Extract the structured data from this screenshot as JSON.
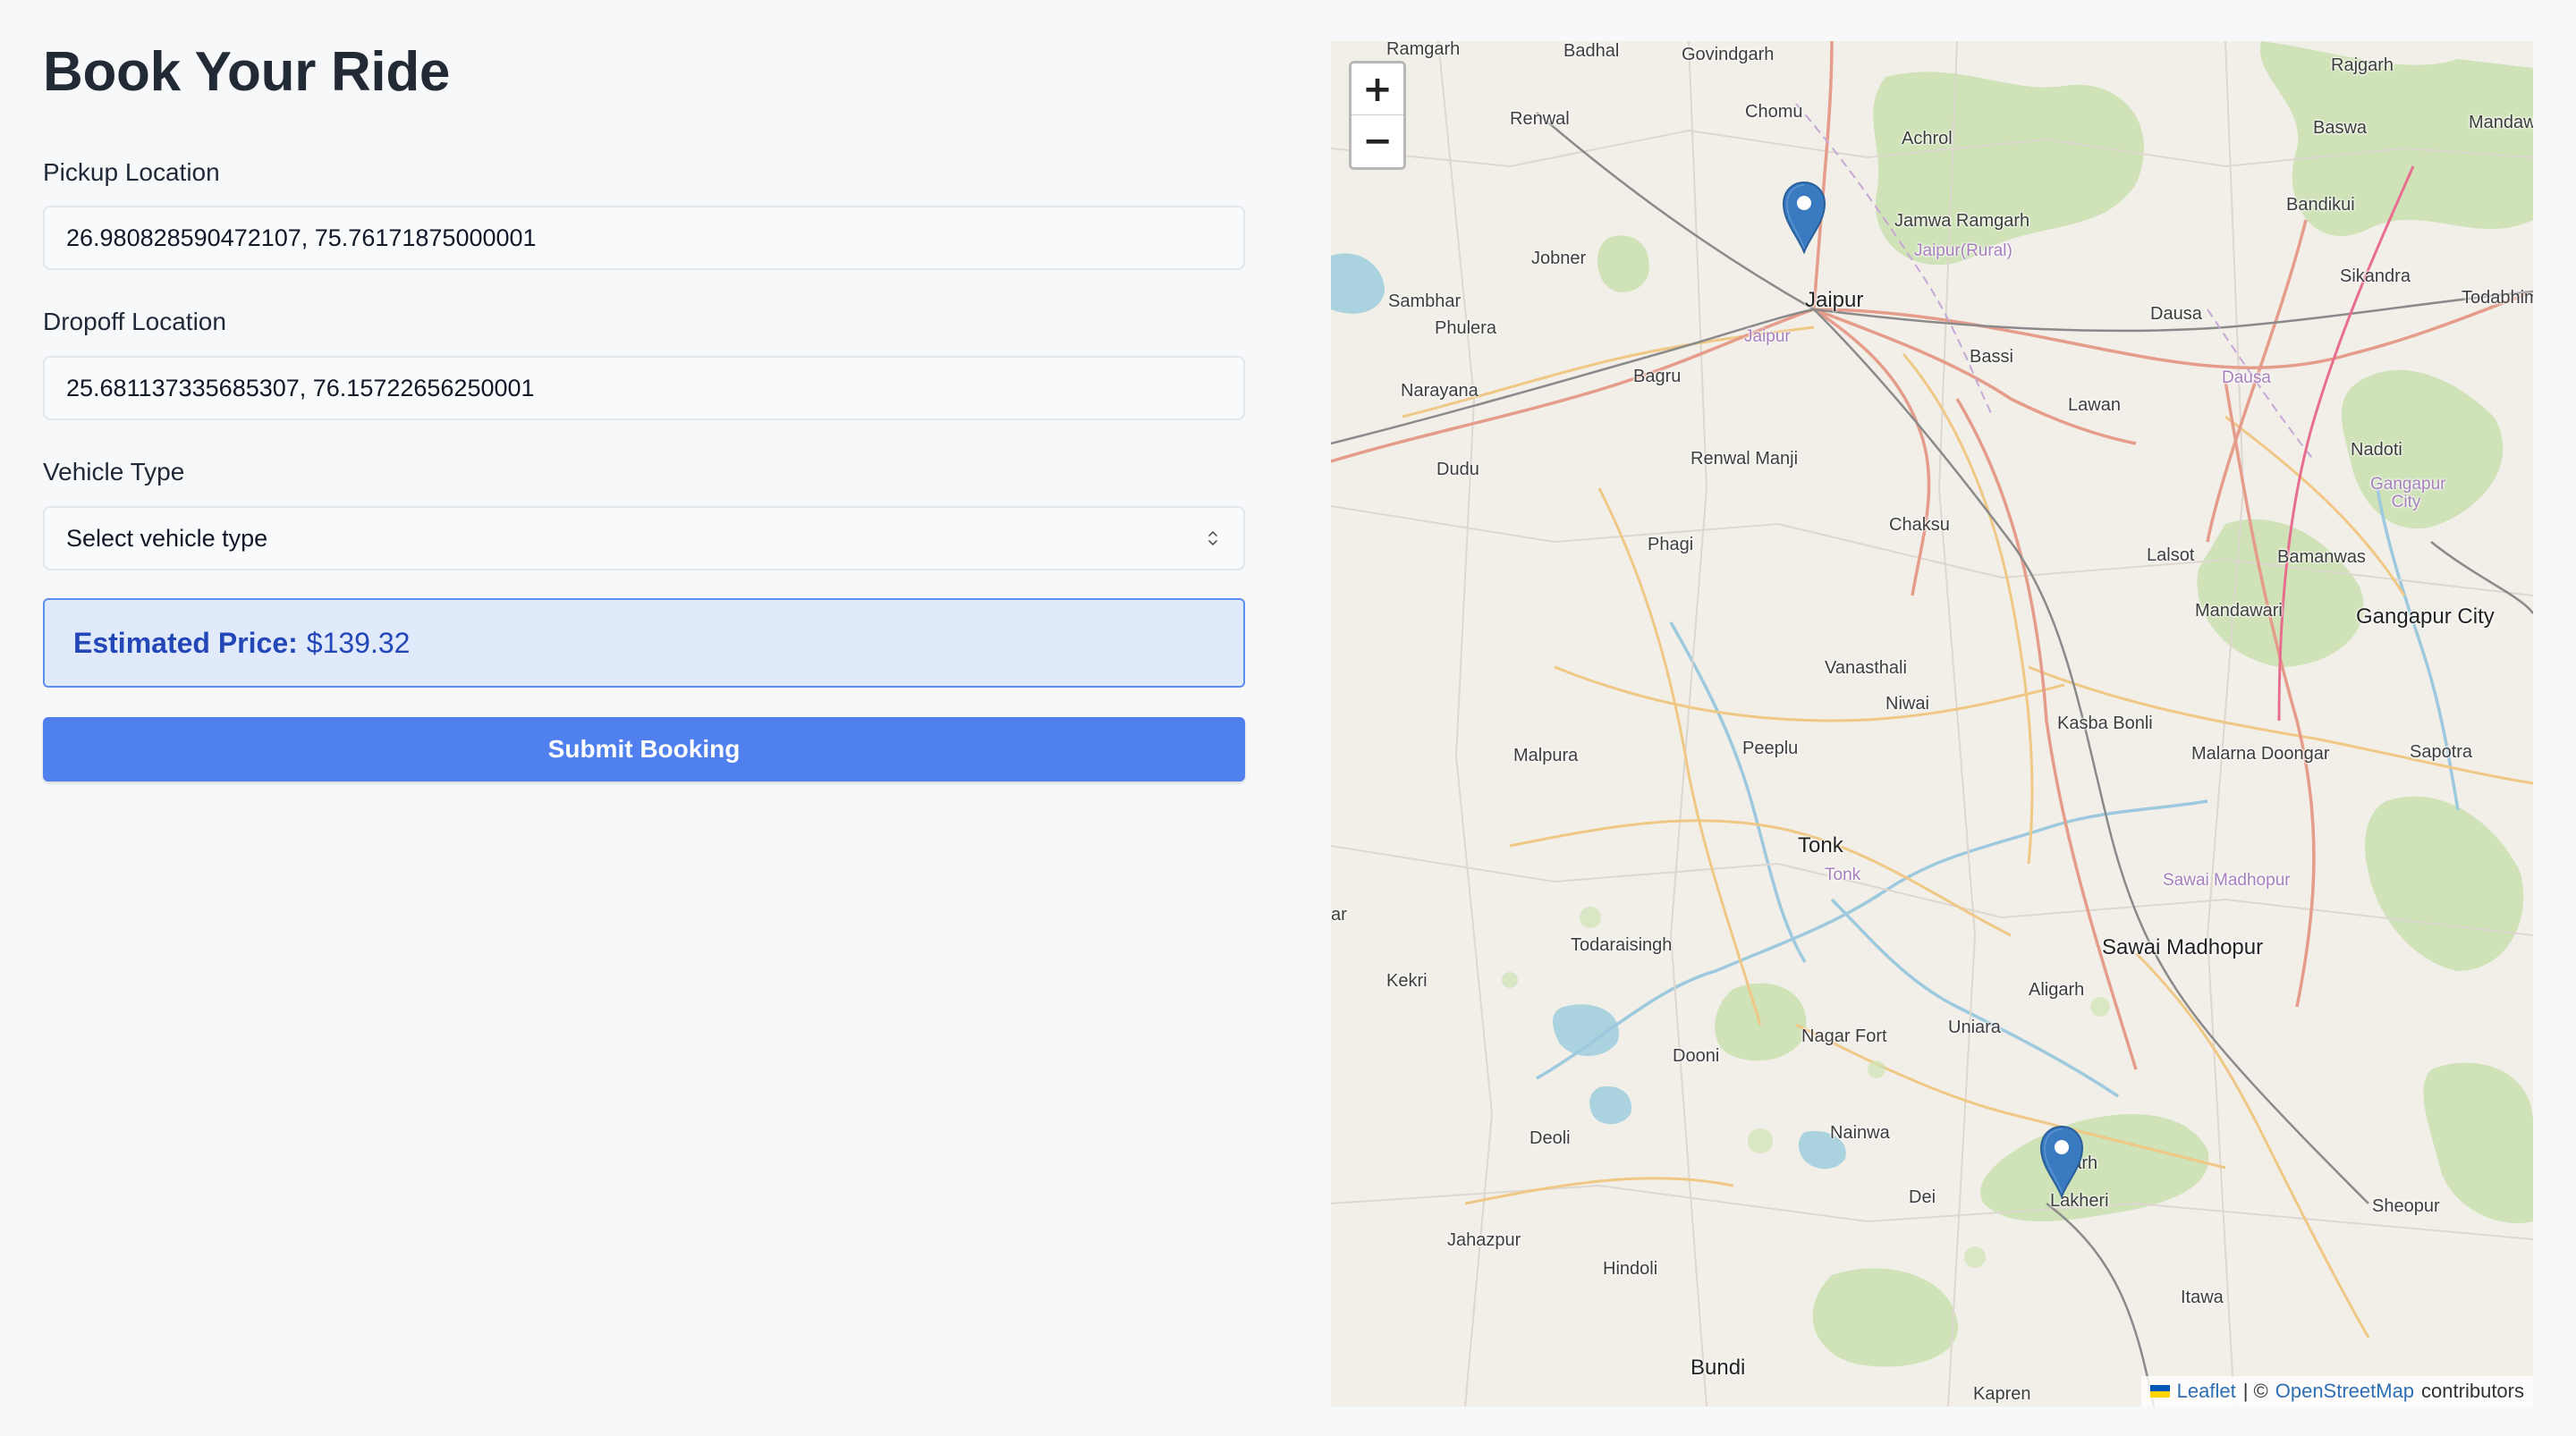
{
  "form": {
    "title": "Book Your Ride",
    "pickup": {
      "label": "Pickup Location",
      "value": "26.980828590472107, 75.76171875000001"
    },
    "dropoff": {
      "label": "Dropoff Location",
      "value": "25.681137335685307, 76.15722656250001"
    },
    "vehicle": {
      "label": "Vehicle Type",
      "selected": "Select vehicle type",
      "icon": "chevron-updown-icon"
    },
    "price": {
      "label": "Estimated Price:",
      "value": "$139.32"
    },
    "submit_label": "Submit Booking"
  },
  "map": {
    "zoom_in": "+",
    "zoom_out": "−",
    "attribution": {
      "leaflet": "Leaflet",
      "separator": "| ©",
      "osm": "OpenStreetMap",
      "suffix": "contributors"
    },
    "places": {
      "ramgarh": "Ramgarh",
      "badhal": "Badhal",
      "govindgarh": "Govindgarh",
      "rajgarh": "Rajgarh",
      "renwal": "Renwal",
      "chomu": "Chomu",
      "achrol": "Achrol",
      "basw": "Baswa",
      "mandaw": "Mandaw",
      "bandikui": "Bandikui",
      "jamwa": "Jamwa Ramgarh",
      "jaipurrural": "Jaipur(Rural)",
      "jobner": "Jobner",
      "sikandra": "Sikandra",
      "sambhar": "Sambhar",
      "jaipur": "Jaipur",
      "todabhim": "Todabhim",
      "phulera": "Phulera",
      "dausa": "Dausa",
      "jaipur2": "Jaipur",
      "bassi": "Bassi",
      "bagru": "Bagru",
      "dausa2": "Dausa",
      "narayana": "Narayana",
      "lawan": "Lawan",
      "nadoti": "Nadoti",
      "renwalmanji": "Renwal Manji",
      "dudu": "Dudu",
      "gangapurcity2": "Gangapur City",
      "chaksu": "Chaksu",
      "phagi": "Phagi",
      "lalsot": "Lalsot",
      "bamanwas": "Bamanwas",
      "mandawari": "Mandawari",
      "gangapurcity": "Gangapur City",
      "vanasthali": "Vanasthali",
      "niwai": "Niwai",
      "kasbabonli": "Kasba Bonli",
      "malpura": "Malpura",
      "peeplu": "Peeplu",
      "malarna": "Malarna Doongar",
      "sapotra": "Sapotra",
      "tonk": "Tonk",
      "tonk2": "Tonk",
      "sawaimadhopur2": "Sawai Madhopur",
      "ar": "ar",
      "todaraisingh": "Todaraisingh",
      "sawaimadhopur": "Sawai Madhopur",
      "kekri": "Kekri",
      "aligarh": "Aligarh",
      "uniara": "Uniara",
      "nagarfort": "Nagar Fort",
      "dooni": "Dooni",
      "deoli": "Deoli",
      "nainwa": "Nainwa",
      "indragarh": "agarh",
      "lakheri": "Lakheri",
      "dei": "Dei",
      "jahazpur": "Jahazpur",
      "sheopur": "Sheopur",
      "hindoli": "Hindoli",
      "itawa": "Itawa",
      "bundi": "Bundi",
      "kapren": "Kapren"
    }
  }
}
